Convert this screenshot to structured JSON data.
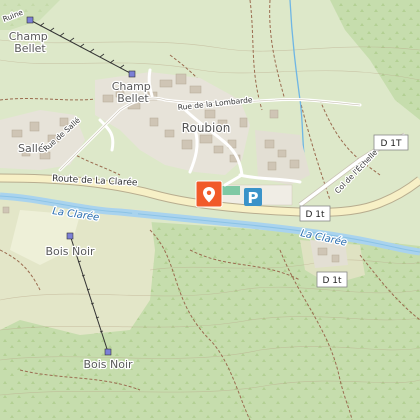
{
  "map": {
    "places": {
      "champ_bellet_top": "Champ\nBellet",
      "champ_bellet": "Champ\nBellet",
      "roubion": "Roubion",
      "salle": "Sallé",
      "bois_noir_north": "Bois Noir",
      "bois_noir_south": "Bois Noir",
      "ruine": "Ruine"
    },
    "streets": {
      "rue_de_la_lombarde": "Rue de la Lombarde",
      "rue_de_salle": "Rue de Sallé",
      "route_de_la_claree": "Route de La Clarée",
      "col_de_lechelle": "Col de l'Échelle"
    },
    "rivers": {
      "la_claree_west": "La Clarée",
      "la_claree_east": "La Clarée"
    },
    "road_shields": {
      "d1t_north": "D 1T",
      "d1t_middle": "D 1t",
      "d1t_south": "D 1t"
    },
    "parking_label": "P",
    "colors": {
      "meadow": "#dde8c9",
      "forest": "#c4dcab",
      "urban": "#e7e3d9",
      "water": "#a9d3ee",
      "river_text": "#2a6fb0",
      "marker": "#f15a29",
      "parking": "#3a93c9"
    },
    "marker_icon": "location-pin-icon"
  }
}
